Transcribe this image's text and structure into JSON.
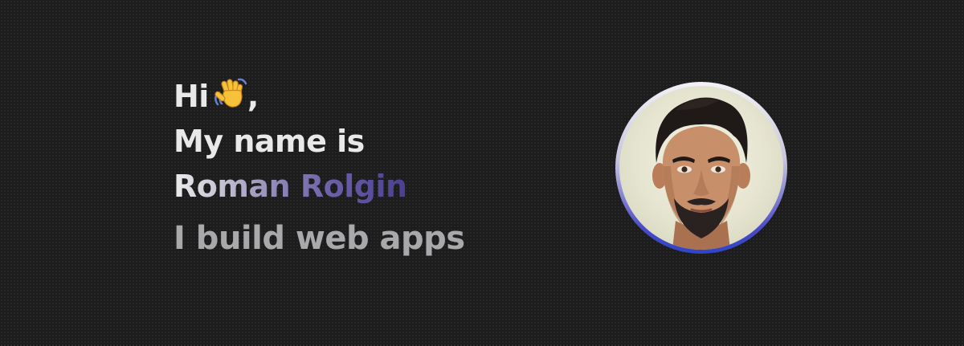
{
  "hero": {
    "greeting": "Hi",
    "greeting_punct": ",",
    "wave_icon": "waving-hand-icon",
    "intro_line": "My name is",
    "name": "Roman Rolgin",
    "tagline": "I build web apps",
    "avatar_icon": "profile-photo"
  },
  "colors": {
    "background": "#1c1c1d",
    "text_primary": "#e9e9ea",
    "text_secondary": "#a9a9ab",
    "name_gradient_end": "#4a3f8f",
    "avatar_ring_bottom": "#2f45c6"
  }
}
